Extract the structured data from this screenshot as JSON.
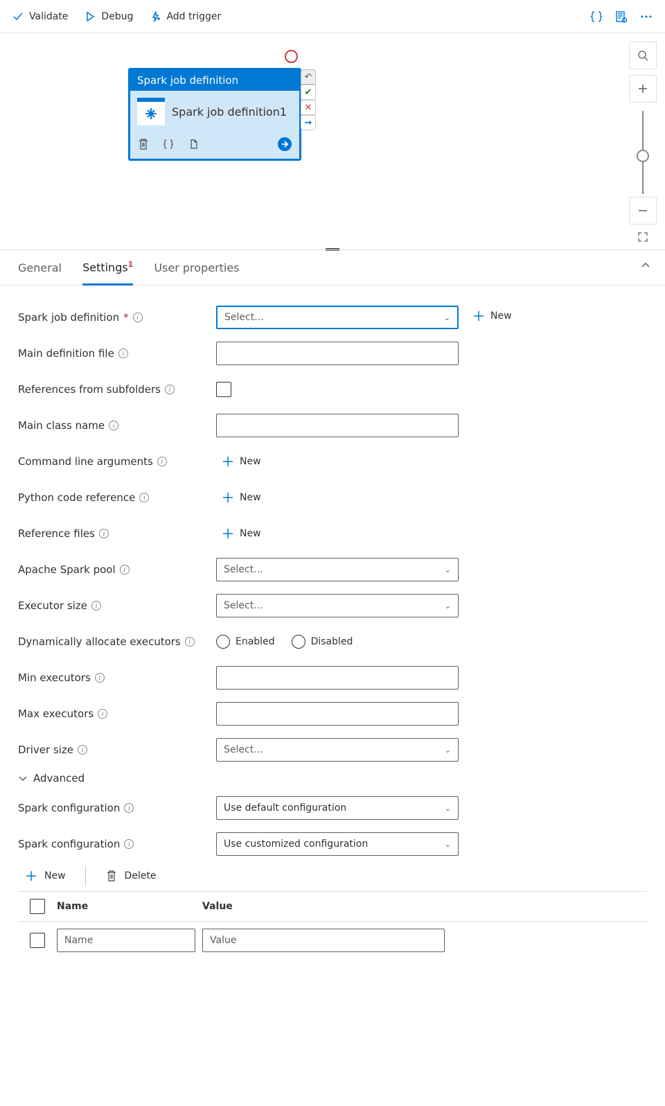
{
  "toolbar": {
    "validate": "Validate",
    "debug": "Debug",
    "add_trigger": "Add trigger"
  },
  "node": {
    "header": "Spark job definition",
    "title": "Spark job definition1"
  },
  "tabs": {
    "general": "General",
    "settings": "Settings",
    "settings_badge": "1",
    "user_properties": "User properties"
  },
  "form": {
    "spark_job_def_label": "Spark job definition",
    "spark_job_def_placeholder": "Select...",
    "new_label": "New",
    "main_def_file_label": "Main definition file",
    "refs_subfolders_label": "References from subfolders",
    "main_class_label": "Main class name",
    "cmd_args_label": "Command line arguments",
    "python_ref_label": "Python code reference",
    "ref_files_label": "Reference files",
    "spark_pool_label": "Apache Spark pool",
    "spark_pool_placeholder": "Select...",
    "executor_size_label": "Executor size",
    "executor_size_placeholder": "Select...",
    "dyn_exec_label": "Dynamically allocate executors",
    "dyn_exec_enabled": "Enabled",
    "dyn_exec_disabled": "Disabled",
    "min_exec_label": "Min executors",
    "max_exec_label": "Max executors",
    "driver_size_label": "Driver size",
    "driver_size_placeholder": "Select...",
    "advanced_label": "Advanced",
    "spark_config_label": "Spark configuration",
    "spark_config_default": "Use default configuration",
    "spark_config_custom": "Use customized configuration",
    "config_new": "New",
    "config_delete": "Delete",
    "col_name": "Name",
    "col_value": "Value",
    "name_placeholder": "Name",
    "value_placeholder": "Value"
  }
}
